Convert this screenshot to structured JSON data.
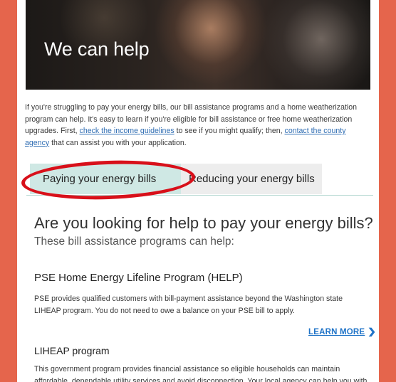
{
  "colors": {
    "background": "#e5654c",
    "active_tab": "#cfe8e4",
    "inactive_tab": "#ededed",
    "link": "#2f6db3",
    "learn_more": "#1f73c7",
    "annotation_ring": "#d8101a"
  },
  "hero": {
    "title": "We can help"
  },
  "intro": {
    "text_1": "If you're struggling to pay your energy bills, our bill assistance programs and a home weatherization program can help. It's easy to learn if you're eligible for bill assistance or free home weatherization upgrades. First, ",
    "link_income": "check the income guidelines",
    "text_2": " to see if you might qualify; then, ",
    "link_agency": "contact the county agency",
    "text_3": " that can assist you with your application."
  },
  "tabs": [
    {
      "label": "Paying your energy bills",
      "active": true
    },
    {
      "label": "Reducing your energy bills",
      "active": false
    }
  ],
  "main": {
    "heading": "Are you looking for help to pay your energy bills?",
    "subheading": "These bill assistance programs can help:"
  },
  "programs": [
    {
      "title": "PSE Home Energy Lifeline Program (HELP)",
      "body": "PSE provides qualified customers with bill-payment assistance beyond the Washington state LIHEAP program. You do not need to owe a balance on your PSE bill to apply.",
      "cta": "LEARN MORE",
      "cta_icon": "chevron-right-icon"
    },
    {
      "title": "LIHEAP program",
      "body": "This government program provides financial assistance so eligible households can maintain affordable, dependable utility services and avoid disconnection. Your local agency can help you with"
    }
  ]
}
